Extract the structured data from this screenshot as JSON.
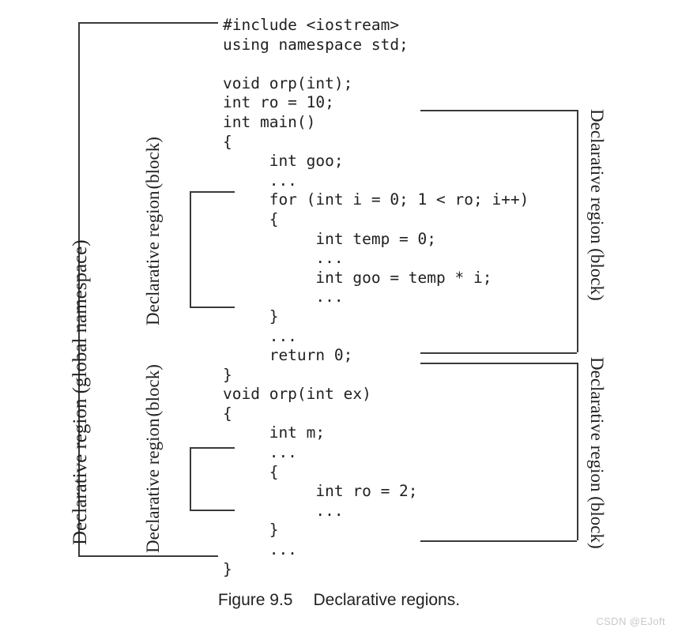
{
  "figure": {
    "caption_number": "Figure 9.5",
    "caption_text": "Declarative regions.",
    "watermark": "CSDN @EJoft"
  },
  "code": {
    "lines": [
      "#include <iostream>",
      "using namespace std;",
      "",
      "void orp(int);",
      "int ro = 10;",
      "int main()",
      "{",
      "     int goo;",
      "     ...",
      "     for (int i = 0; 1 < ro; i++)",
      "     {",
      "          int temp = 0;",
      "          ...",
      "          int goo = temp * i;",
      "          ...",
      "     }",
      "     ...",
      "     return 0;",
      "}",
      "void orp(int ex)",
      "{",
      "     int m;",
      "     ...",
      "     {",
      "          int ro = 2;",
      "          ...",
      "     }",
      "     ...",
      "}"
    ]
  },
  "labels": {
    "global": "Declarative region (global namespace)",
    "left_block_1": {
      "line1": "Declarative region",
      "line2": "(block)"
    },
    "left_block_2": {
      "line1": "Declarative region",
      "line2": "(block)"
    },
    "right_block_1": "Declarative region (block)",
    "right_block_2": "Declarative region (block)"
  },
  "colors": {
    "line": "#3a3a3c",
    "text": "#231f20",
    "background": "#ffffff",
    "watermark": "#c9c9c9"
  }
}
